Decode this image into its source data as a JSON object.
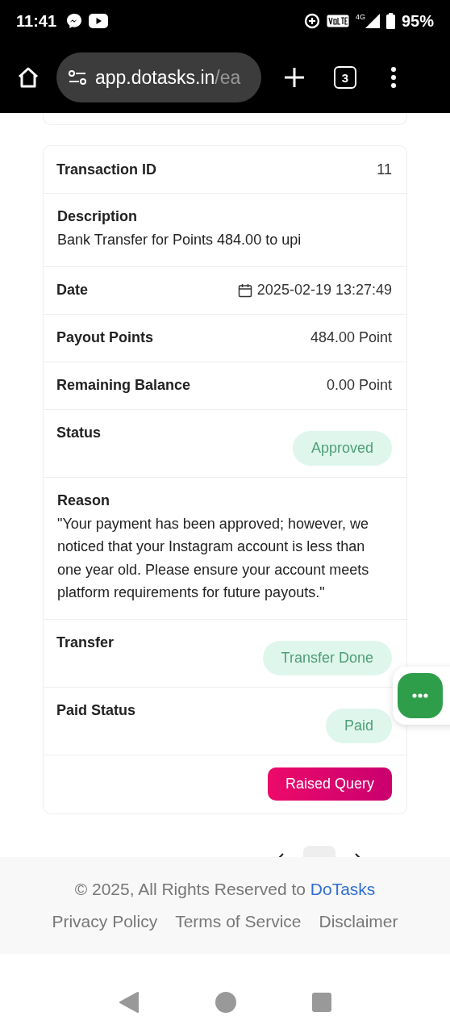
{
  "status_bar": {
    "time": "11:41",
    "network": "4G",
    "battery": "95%"
  },
  "browser": {
    "url_host": "app.dotasks.in",
    "url_path": "/ea",
    "tab_count": "3"
  },
  "transaction": [
    {
      "kind": "pair",
      "label": "Transaction ID",
      "value": "11"
    },
    {
      "kind": "block",
      "label": "Description",
      "value": "Bank Transfer for Points 484.00 to upi"
    },
    {
      "kind": "date",
      "label": "Date",
      "value": "2025-02-19 13:27:49"
    },
    {
      "kind": "pair",
      "label": "Payout Points",
      "value": "484.00 Point"
    },
    {
      "kind": "pair",
      "label": "Remaining Balance",
      "value": "0.00 Point"
    },
    {
      "kind": "badge",
      "label": "Status",
      "value": "Approved"
    },
    {
      "kind": "block",
      "label": "Reason",
      "value": "\"Your payment has been approved; however, we noticed that your Instagram account is less than one year old. Please ensure your account meets platform requirements for future payouts.\""
    },
    {
      "kind": "badge",
      "label": "Transfer",
      "value": "Transfer Done"
    },
    {
      "kind": "badge",
      "label": "Paid Status",
      "value": "Paid"
    },
    {
      "kind": "button",
      "value": "Raised Query"
    }
  ],
  "footer": {
    "copyright": "© 2025, All Rights Reserved to ",
    "brand": "DoTasks",
    "links": [
      "Privacy Policy",
      "Terms of Service",
      "Disclaimer"
    ]
  }
}
